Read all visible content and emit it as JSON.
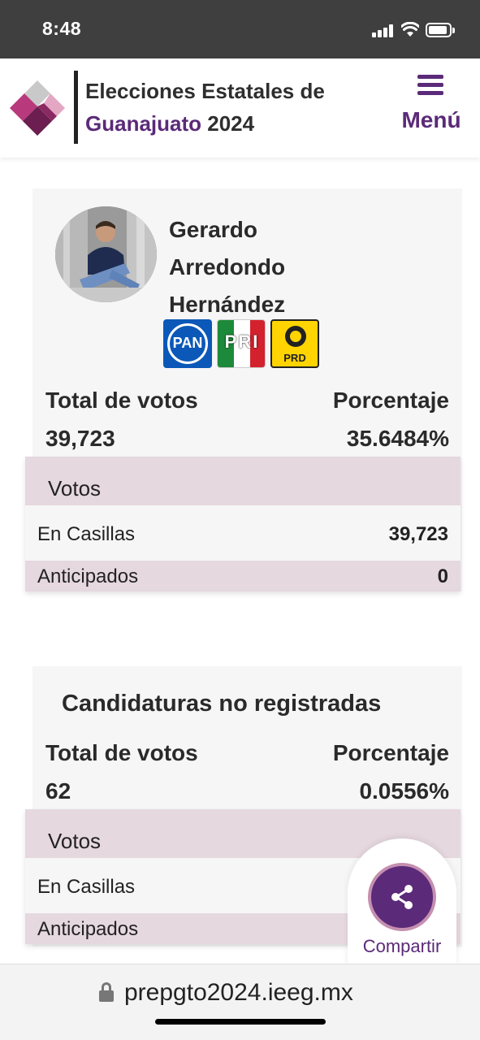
{
  "status_bar": {
    "time": "8:48"
  },
  "header": {
    "title_line1": "Elecciones Estatales de",
    "title_place": "Guanajuato",
    "title_year": " 2024",
    "menu_label": "Menú",
    "brand_color": "#5b2a79"
  },
  "candidate": {
    "name": "Gerardo Arredondo Hernández",
    "parties": [
      "PAN",
      "PRI",
      "PRD"
    ],
    "total_label": "Total de votos",
    "total_value": "39,723",
    "percent_label": "Porcentaje",
    "percent_value": "35.6484%",
    "table": {
      "header": "Votos",
      "rows": [
        {
          "label": "En Casillas",
          "value": "39,723"
        },
        {
          "label": "Anticipados",
          "value": "0"
        }
      ]
    }
  },
  "unregistered": {
    "title": "Candidaturas no registradas",
    "total_label": "Total de votos",
    "total_value": "62",
    "percent_label": "Porcentaje",
    "percent_value": "0.0556%",
    "table": {
      "header": "Votos",
      "rows": [
        {
          "label": "En Casillas",
          "value": ""
        },
        {
          "label": "Anticipados",
          "value": ""
        }
      ]
    }
  },
  "share": {
    "label": "Compartir",
    "icon": "share-icon"
  },
  "browser": {
    "url": "prepgto2024.ieeg.mx",
    "icon": "lock-icon"
  }
}
